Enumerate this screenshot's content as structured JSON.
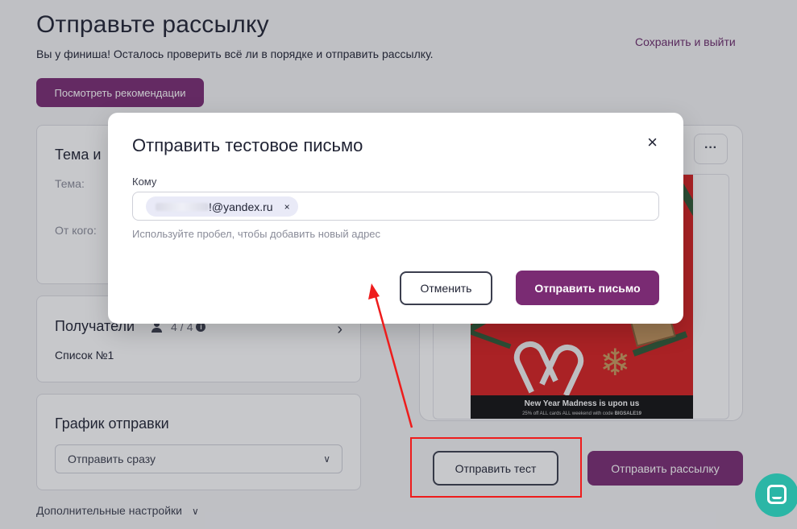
{
  "page": {
    "title": "Отправьте рассылку",
    "subtitle": "Вы у финиша! Осталось проверить всё ли в порядке и отправить рассылку.",
    "save_exit": "Сохранить и выйти",
    "recommendations_button": "Посмотреть рекомендации"
  },
  "theme_card": {
    "title": "Тема и",
    "subject_label": "Тема:",
    "from_label": "От кого:"
  },
  "recipients_card": {
    "title": "Получатели",
    "count": "4",
    "separator": "/",
    "total": "4",
    "list_name": "Список №1"
  },
  "schedule_card": {
    "title": "График отправки",
    "selected_option": "Отправить сразу"
  },
  "extra_settings": "Дополнительные настройки",
  "preview": {
    "more_label": "···",
    "email_headline": "New Year Madness is upon us",
    "email_subline_prefix": "25% off ALL cards ALL weekend with code ",
    "email_code": "BIGSALE19"
  },
  "actions": {
    "send_test": "Отправить тест",
    "send_campaign": "Отправить рассылку"
  },
  "modal": {
    "title": "Отправить тестовое письмо",
    "close": "×",
    "to_label": "Кому",
    "recipient_visible": "!@yandex.ru",
    "chip_remove": "×",
    "hint": "Используйте пробел, чтобы добавить новый адрес",
    "cancel": "Отменить",
    "send": "Отправить письмо"
  },
  "colors": {
    "brand": "#7a2b73",
    "annotation": "#ee1c1c",
    "chat": "#2bb6a6"
  },
  "icons": {
    "people": "people-icon",
    "info": "info-icon",
    "chevron_right": "chevron-right-icon",
    "chevron_down": "chevron-down-icon",
    "close": "close-icon",
    "chat": "chat-icon"
  }
}
